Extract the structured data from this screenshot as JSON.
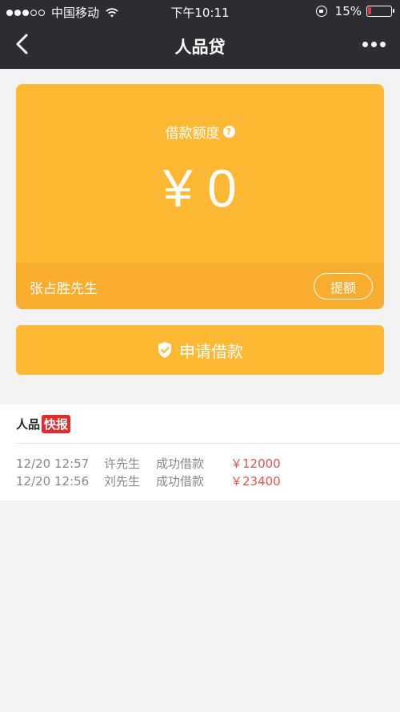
{
  "status_bar": {
    "carrier": "中国移动",
    "time": "下午10:11",
    "battery_percent": "15%",
    "battery_level": 0.15
  },
  "nav": {
    "title": "人品贷",
    "back_icon": "chevron-left-icon",
    "more_icon": "more-horizontal-icon"
  },
  "card": {
    "label": "借款额度",
    "help_icon": "question-icon",
    "help_glyph": "?",
    "amount": "¥ 0",
    "user_name": "张占胜先生",
    "raise_button": "提额"
  },
  "apply_button": {
    "label": "申请借款",
    "icon": "shield-check-icon"
  },
  "news": {
    "title_prefix": "人品",
    "title_badge": "快报",
    "items": [
      {
        "time": "12/20 12:57",
        "name": "许先生",
        "action": "成功借款",
        "amount": "￥12000"
      },
      {
        "time": "12/20 12:56",
        "name": "刘先生",
        "action": "成功借款",
        "amount": "￥23400"
      }
    ]
  },
  "colors": {
    "topbar": "#2b2d31",
    "accent": "#fdb934",
    "accent_dark": "#f9ad2f",
    "highlight_red": "#e02c2c",
    "amount_red": "#e8534a",
    "background": "#f3f3f3"
  }
}
